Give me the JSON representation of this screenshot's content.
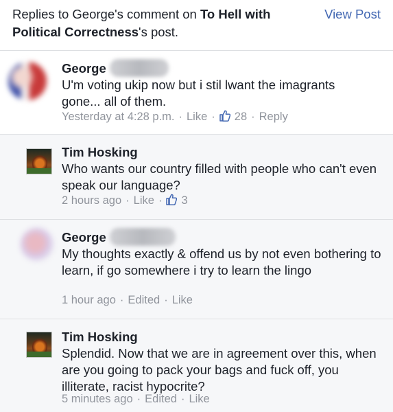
{
  "header": {
    "prefix": "Replies to George's comment on ",
    "page_name": "To Hell with Political Correctness",
    "suffix": "'s post.",
    "view_post": "View Post"
  },
  "comments": [
    {
      "name": "George",
      "text": "U'm voting ukip now but i stil lwant the imagrants gone... all of them.",
      "time": "Yesterday at 4:28 p.m.",
      "like": "Like",
      "likes": "28",
      "reply": "Reply"
    },
    {
      "name": "Tim Hosking",
      "text": "Who wants our country filled with people who can't even speak our language?",
      "time": "2 hours ago",
      "like": "Like",
      "likes": "3"
    },
    {
      "name": "George",
      "text": "My thoughts exactly & offend us by not even bothering to learn, if go somewhere i try to learn the lingo",
      "time": "1 hour ago",
      "edited": "Edited",
      "like": "Like"
    },
    {
      "name": "Tim Hosking",
      "text": "Splendid. Now that we are in agreement over this, when are you going to pack your bags and fuck off, you illiterate, racist hypocrite?",
      "time": "5 minutes ago",
      "edited": "Edited",
      "like": "Like"
    }
  ],
  "colors": {
    "link": "#4267b2",
    "meta": "#90949c",
    "text": "#1d2129",
    "reply_bg": "#f6f7f9"
  }
}
